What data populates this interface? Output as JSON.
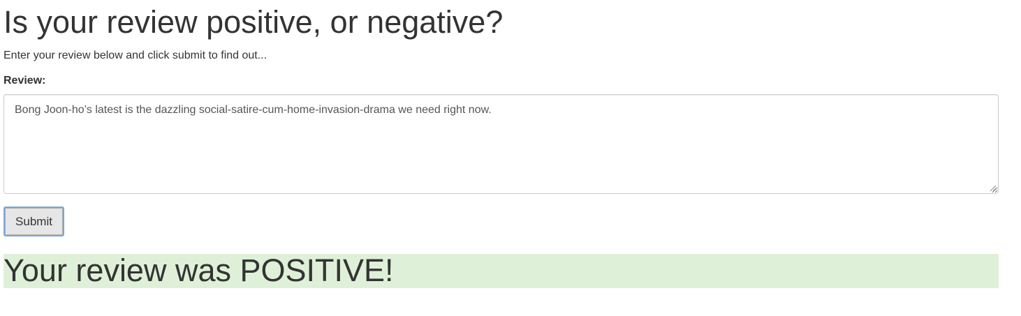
{
  "page": {
    "title": "Is your review positive, or negative?",
    "intro": "Enter your review below and click submit to find out..."
  },
  "form": {
    "review_label": "Review:",
    "review_value": "Bong Joon-ho’s latest is the dazzling social-satire-cum-home-invasion-drama we need right now.",
    "submit_label": "Submit"
  },
  "result": {
    "text": "Your review was POSITIVE!",
    "sentiment": "positive",
    "banner_color": "#dff0d8"
  }
}
